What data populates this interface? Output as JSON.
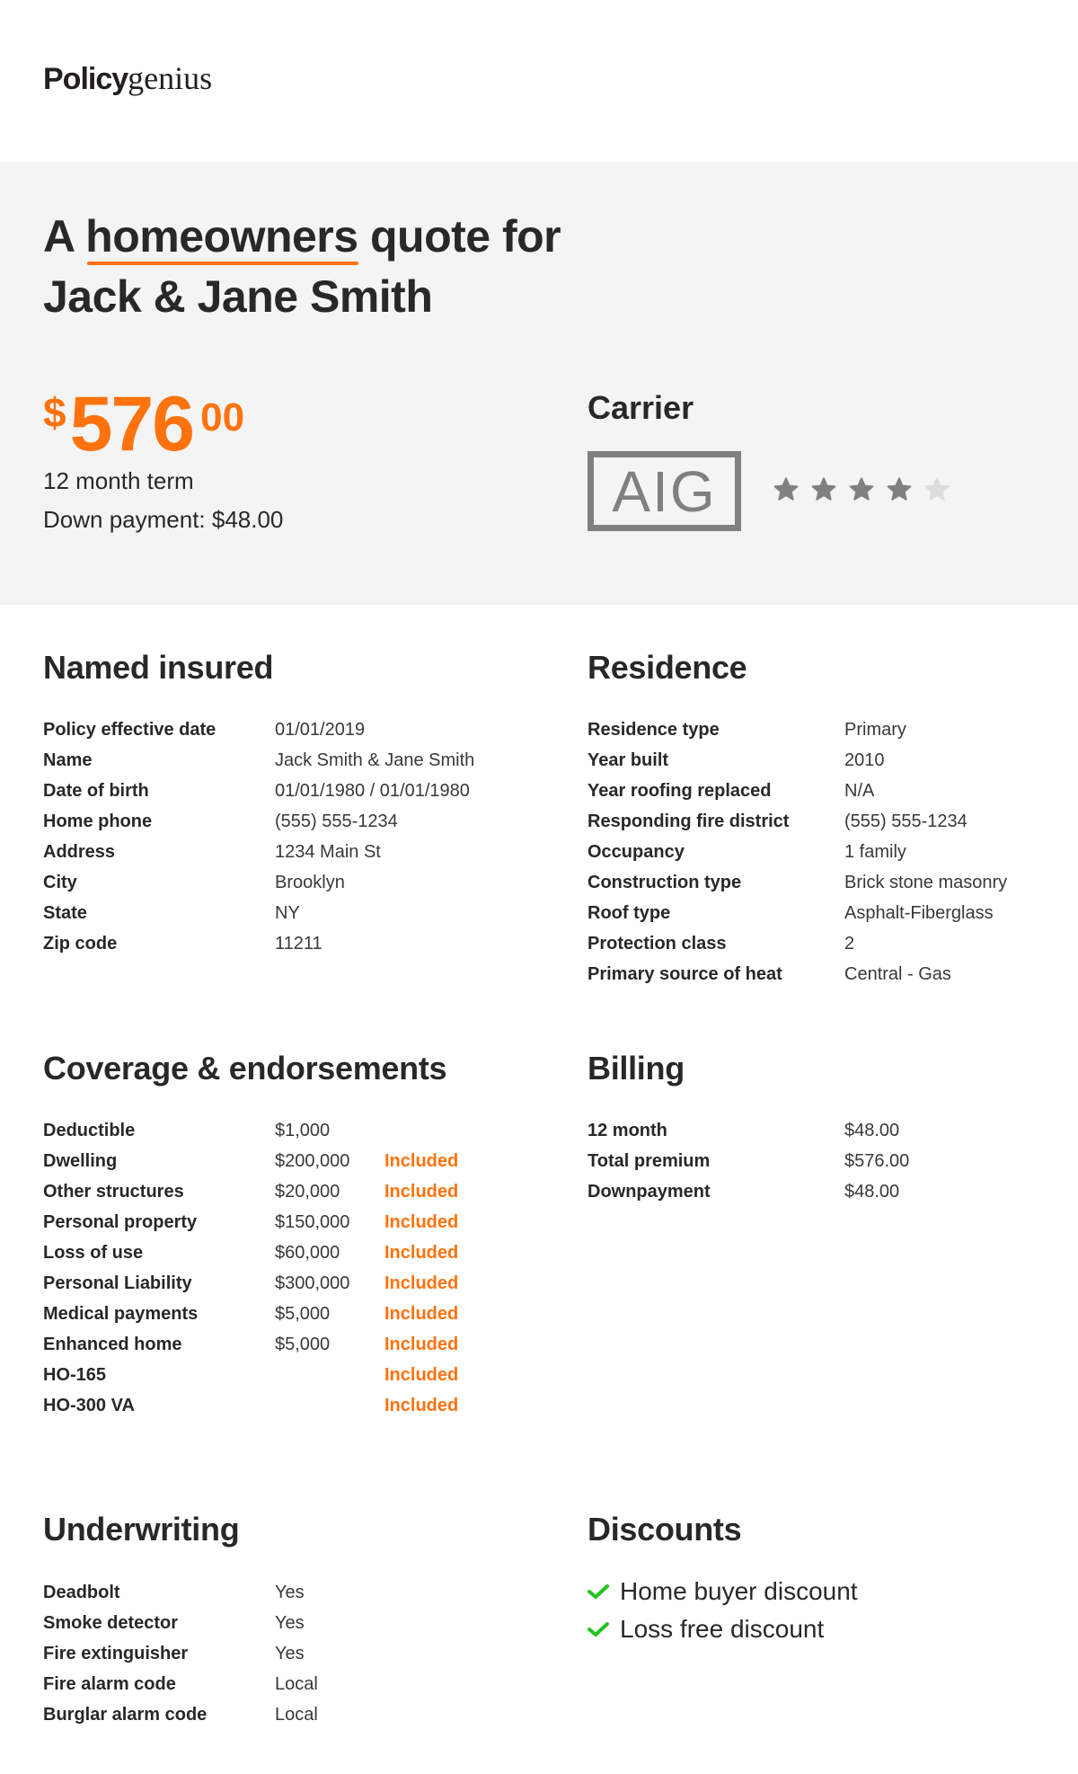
{
  "brand": {
    "bold": "Policy",
    "light": "genius"
  },
  "hero": {
    "title_prefix": "A",
    "title_highlight": "homeowners",
    "title_suffix": "quote for",
    "title_line2": "Jack & Jane Smith",
    "accent_color": "#ff720e",
    "price": {
      "currency": "$",
      "dollars": "576",
      "cents": "00"
    },
    "term": "12 month term",
    "down_payment": "Down payment: $48.00"
  },
  "carrier": {
    "title": "Carrier",
    "logo_text": "AIG",
    "rating": 4,
    "rating_max": 5
  },
  "named_insured": {
    "title": "Named insured",
    "rows": [
      {
        "label": "Policy effective date",
        "value": "01/01/2019"
      },
      {
        "label": "Name",
        "value": "Jack Smith & Jane Smith"
      },
      {
        "label": "Date of birth",
        "value": "01/01/1980 / 01/01/1980"
      },
      {
        "label": "Home phone",
        "value": "(555) 555-1234"
      },
      {
        "label": "Address",
        "value": "1234 Main St"
      },
      {
        "label": "City",
        "value": "Brooklyn"
      },
      {
        "label": "State",
        "value": "NY"
      },
      {
        "label": "Zip code",
        "value": "11211"
      }
    ]
  },
  "residence": {
    "title": "Residence",
    "rows": [
      {
        "label": "Residence type",
        "value": "Primary"
      },
      {
        "label": "Year built",
        "value": "2010"
      },
      {
        "label": "Year roofing replaced",
        "value": "N/A"
      },
      {
        "label": "Responding fire district",
        "value": "(555) 555-1234"
      },
      {
        "label": "Occupancy",
        "value": "1 family"
      },
      {
        "label": "Construction type",
        "value": "Brick stone masonry"
      },
      {
        "label": "Roof type",
        "value": "Asphalt-Fiberglass"
      },
      {
        "label": "Protection class",
        "value": "2"
      },
      {
        "label": "Primary source of heat",
        "value": "Central - Gas"
      }
    ]
  },
  "coverage": {
    "title": "Coverage & endorsements",
    "rows": [
      {
        "label": "Deductible",
        "value": "$1,000",
        "status": ""
      },
      {
        "label": "Dwelling",
        "value": "$200,000",
        "status": "Included"
      },
      {
        "label": "Other structures",
        "value": "$20,000",
        "status": "Included"
      },
      {
        "label": "Personal property",
        "value": "$150,000",
        "status": "Included"
      },
      {
        "label": "Loss of use",
        "value": "$60,000",
        "status": "Included"
      },
      {
        "label": "Personal Liability",
        "value": "$300,000",
        "status": "Included"
      },
      {
        "label": "Medical payments",
        "value": "$5,000",
        "status": "Included"
      },
      {
        "label": "Enhanced home",
        "value": "$5,000",
        "status": "Included"
      },
      {
        "label": "HO-165",
        "value": "",
        "status": "Included"
      },
      {
        "label": "HO-300 VA",
        "value": "",
        "status": "Included"
      }
    ]
  },
  "billing": {
    "title": "Billing",
    "rows": [
      {
        "label": "12 month",
        "value": "$48.00"
      },
      {
        "label": "Total premium",
        "value": "$576.00"
      },
      {
        "label": "Downpayment",
        "value": "$48.00"
      }
    ]
  },
  "underwriting": {
    "title": "Underwriting",
    "rows": [
      {
        "label": "Deadbolt",
        "value": "Yes"
      },
      {
        "label": "Smoke detector",
        "value": "Yes"
      },
      {
        "label": "Fire extinguisher",
        "value": "Yes"
      },
      {
        "label": "Fire alarm code",
        "value": "Local"
      },
      {
        "label": "Burglar alarm code",
        "value": "Local"
      }
    ]
  },
  "discounts": {
    "title": "Discounts",
    "check_color": "#22c31e",
    "items": [
      {
        "label": "Home buyer discount",
        "icon": "check-icon"
      },
      {
        "label": "Loss free discount",
        "icon": "check-icon"
      }
    ]
  }
}
